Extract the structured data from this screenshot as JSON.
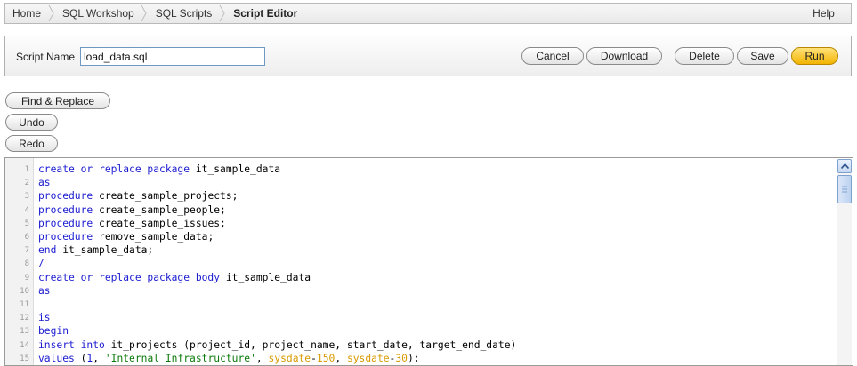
{
  "breadcrumb": {
    "items": [
      "Home",
      "SQL Workshop",
      "SQL Scripts",
      "Script Editor"
    ],
    "help": "Help"
  },
  "script": {
    "name_label": "Script Name",
    "name_value": "load_data.sql"
  },
  "buttons": {
    "cancel": "Cancel",
    "download": "Download",
    "delete": "Delete",
    "save": "Save",
    "run": "Run"
  },
  "tools": {
    "find_replace": "Find & Replace",
    "undo": "Undo",
    "redo": "Redo"
  },
  "colors": {
    "keyword": "#1b1bd1",
    "string": "#0a7a0a",
    "function": "#d89a00",
    "run_button": "#f3b400"
  },
  "editor": {
    "lines": [
      {
        "n": "1",
        "tokens": [
          {
            "t": "create or replace package",
            "c": "kw"
          },
          {
            "t": " it_sample_data",
            "c": ""
          }
        ]
      },
      {
        "n": "2",
        "tokens": [
          {
            "t": "as",
            "c": "kw"
          }
        ]
      },
      {
        "n": "3",
        "tokens": [
          {
            "t": "procedure",
            "c": "kw"
          },
          {
            "t": " create_sample_projects;",
            "c": ""
          }
        ]
      },
      {
        "n": "4",
        "tokens": [
          {
            "t": "procedure",
            "c": "kw"
          },
          {
            "t": " create_sample_people;",
            "c": ""
          }
        ]
      },
      {
        "n": "5",
        "tokens": [
          {
            "t": "procedure",
            "c": "kw"
          },
          {
            "t": " create_sample_issues;",
            "c": ""
          }
        ]
      },
      {
        "n": "6",
        "tokens": [
          {
            "t": "procedure",
            "c": "kw"
          },
          {
            "t": " remove_sample_data;",
            "c": ""
          }
        ]
      },
      {
        "n": "7",
        "tokens": [
          {
            "t": "end",
            "c": "kw"
          },
          {
            "t": " it_sample_data;",
            "c": ""
          }
        ]
      },
      {
        "n": "8",
        "tokens": [
          {
            "t": "/",
            "c": "kw"
          }
        ]
      },
      {
        "n": "9",
        "tokens": [
          {
            "t": "create or replace package body",
            "c": "kw"
          },
          {
            "t": " it_sample_data",
            "c": ""
          }
        ]
      },
      {
        "n": "10",
        "tokens": [
          {
            "t": "as",
            "c": "kw"
          }
        ]
      },
      {
        "n": "11",
        "tokens": []
      },
      {
        "n": "12",
        "tokens": [
          {
            "t": "is",
            "c": "kw"
          }
        ]
      },
      {
        "n": "13",
        "tokens": [
          {
            "t": "begin",
            "c": "kw"
          }
        ]
      },
      {
        "n": "14",
        "tokens": [
          {
            "t": "insert into",
            "c": "kw"
          },
          {
            "t": " it_projects (project_id, project_name, start_date, target_end_date)",
            "c": ""
          }
        ]
      },
      {
        "n": "15",
        "tokens": [
          {
            "t": "values",
            "c": "kw"
          },
          {
            "t": " (",
            "c": ""
          },
          {
            "t": "1",
            "c": "num"
          },
          {
            "t": ", ",
            "c": ""
          },
          {
            "t": "'Internal Infrastructure'",
            "c": "str"
          },
          {
            "t": ", ",
            "c": ""
          },
          {
            "t": "sysdate",
            "c": "fn"
          },
          {
            "t": "-",
            "c": ""
          },
          {
            "t": "150",
            "c": "fn"
          },
          {
            "t": ", ",
            "c": ""
          },
          {
            "t": "sysdate",
            "c": "fn"
          },
          {
            "t": "-",
            "c": ""
          },
          {
            "t": "30",
            "c": "fn"
          },
          {
            "t": ");",
            "c": ""
          }
        ]
      }
    ]
  }
}
